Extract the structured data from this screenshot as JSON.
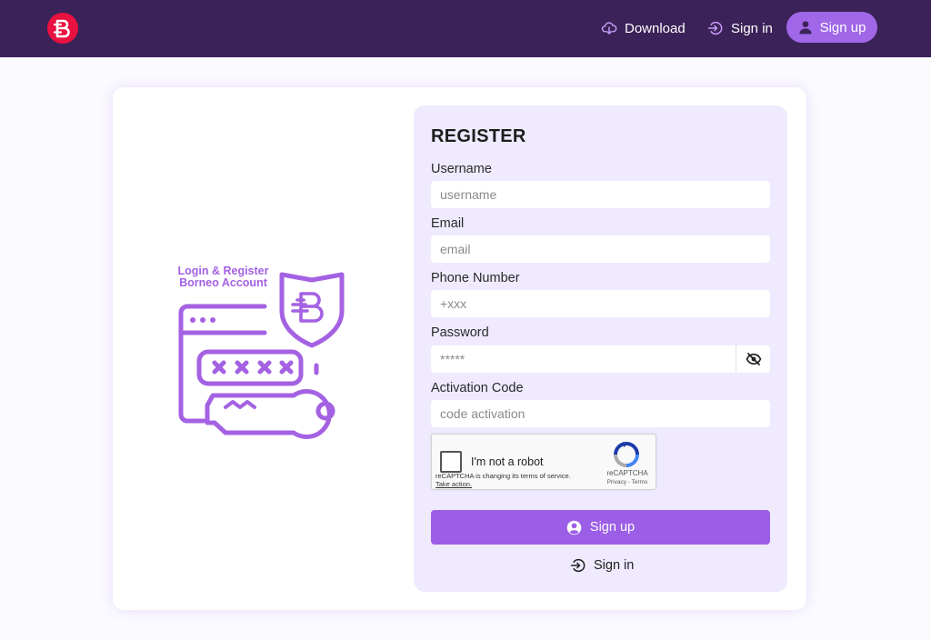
{
  "header": {
    "logo_icon": "borneo-logo-icon",
    "nav": {
      "download": "Download",
      "signin": "Sign in",
      "signup": "Sign up"
    },
    "colors": {
      "bar": "#3b2258",
      "accent": "#a067e8",
      "logo": "#e8113f"
    }
  },
  "illustration": {
    "line1": "Login & Register",
    "line2": "Borneo Account",
    "icon": "password-security-key-icon"
  },
  "form": {
    "title": "REGISTER",
    "username": {
      "label": "Username",
      "placeholder": "username",
      "value": ""
    },
    "email": {
      "label": "Email",
      "placeholder": "email",
      "value": ""
    },
    "phone": {
      "label": "Phone Number",
      "placeholder": "+xxx",
      "value": ""
    },
    "password": {
      "label": "Password",
      "placeholder": "*****",
      "value": "",
      "toggle_icon": "eye-slash-icon"
    },
    "activation": {
      "label": "Activation Code",
      "placeholder": "code activation",
      "value": ""
    },
    "recaptcha": {
      "label": "I'm not a robot",
      "notice": "reCAPTCHA is changing its terms of service.",
      "take_action": "Take action.",
      "brand": "reCAPTCHA",
      "links": "Privacy - Terms"
    },
    "submit": "Sign up",
    "signin": "Sign in",
    "colors": {
      "panel": "#efeafe",
      "button": "#9c5ee6"
    }
  }
}
